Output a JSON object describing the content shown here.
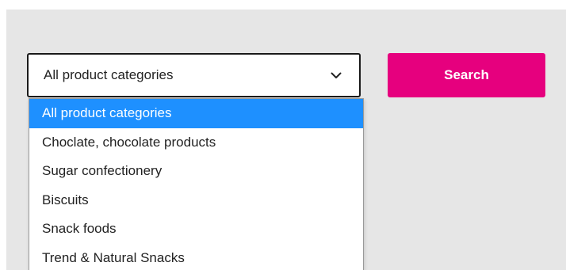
{
  "search_form": {
    "category_select": {
      "selected_value": "All product categories",
      "options": [
        "All product categories",
        "Choclate, chocolate products",
        "Sugar confectionery",
        "Biscuits",
        "Snack foods",
        "Trend & Natural Snacks"
      ],
      "highlighted_index": 0,
      "icon": "chevron-down-icon"
    },
    "search_button_label": "Search"
  },
  "colors": {
    "accent": "#e6007e",
    "highlight": "#1e90ff",
    "panel_bg": "#e6e6e6"
  }
}
